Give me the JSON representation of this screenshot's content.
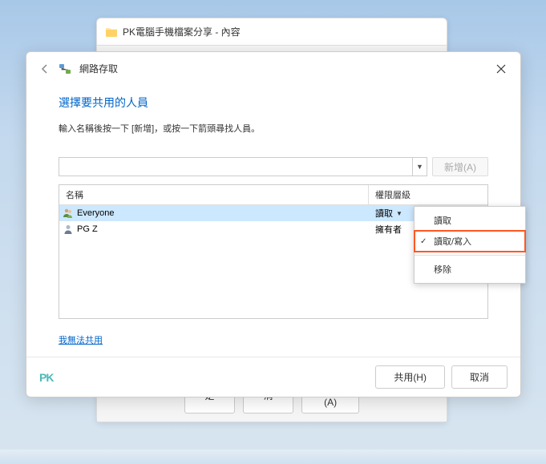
{
  "bg_window": {
    "title": "PK電腦手機檔案分享 - 內容",
    "buttons": {
      "ok": "確定",
      "cancel": "取消",
      "apply": "套用(A)"
    }
  },
  "dialog": {
    "path_title": "網路存取",
    "heading": "選擇要共用的人員",
    "instruction": "輸入名稱後按一下 [新增]，或按一下箭頭尋找人員。",
    "add_button": "新增(A)",
    "columns": {
      "name": "名稱",
      "permission": "權限層級"
    },
    "rows": [
      {
        "name": "Everyone",
        "permission": "讀取",
        "selected": true,
        "has_dropdown": true
      },
      {
        "name": "PG Z",
        "permission": "擁有者",
        "selected": false,
        "has_dropdown": false
      }
    ],
    "menu": {
      "read": "讀取",
      "readwrite": "讀取/寫入",
      "remove": "移除"
    },
    "help_link": "我無法共用",
    "footer": {
      "share": "共用(H)",
      "cancel": "取消"
    },
    "logo": "PK"
  }
}
